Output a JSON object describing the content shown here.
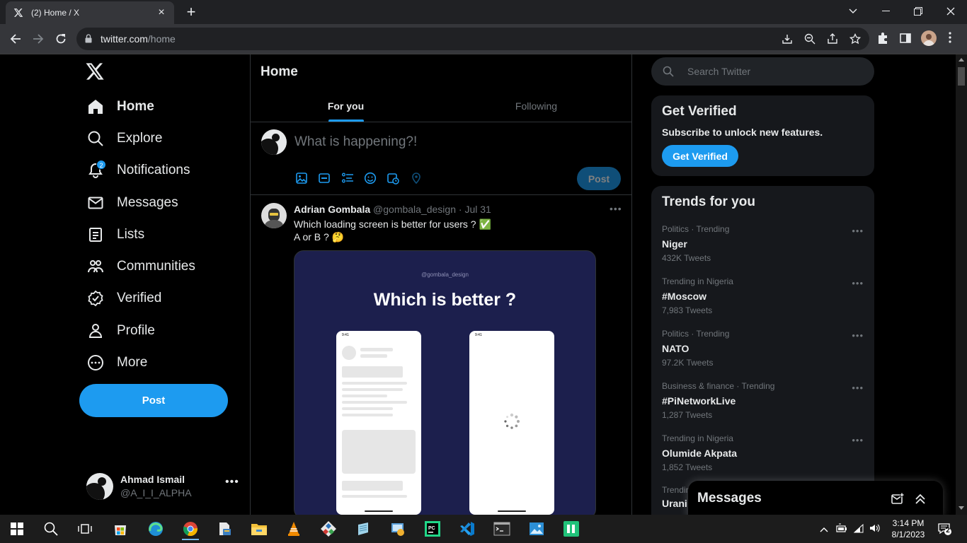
{
  "browser": {
    "tab_title": "(2) Home / X",
    "url_domain": "twitter.com",
    "url_path": "/home"
  },
  "sidebar": {
    "items": [
      {
        "label": "Home",
        "icon": "home-icon"
      },
      {
        "label": "Explore",
        "icon": "search-icon"
      },
      {
        "label": "Notifications",
        "icon": "bell-icon",
        "badge": "2"
      },
      {
        "label": "Messages",
        "icon": "envelope-icon"
      },
      {
        "label": "Lists",
        "icon": "list-icon"
      },
      {
        "label": "Communities",
        "icon": "people-icon"
      },
      {
        "label": "Verified",
        "icon": "verified-badge-icon"
      },
      {
        "label": "Profile",
        "icon": "person-icon"
      },
      {
        "label": "More",
        "icon": "more-circle-icon"
      }
    ],
    "post_button": "Post",
    "account": {
      "name": "Ahmad Ismail",
      "handle": "@A_I_I_ALPHA"
    }
  },
  "main": {
    "title": "Home",
    "tabs": [
      {
        "label": "For you"
      },
      {
        "label": "Following"
      }
    ],
    "composer": {
      "placeholder": "What is happening?!",
      "post_button": "Post"
    },
    "tweet": {
      "author": "Adrian Gombala",
      "handle": "@gombala_design",
      "date": "· Jul 31",
      "line1": "Which loading screen is better for users ? ✅",
      "line2": "A or B ? 🤔",
      "media_watermark": "@gombala_design",
      "media_title": "Which is better ?",
      "phone_a_time": "9:41",
      "phone_b_time": "9:41"
    }
  },
  "right": {
    "search_placeholder": "Search Twitter",
    "verified": {
      "title": "Get Verified",
      "subtitle": "Subscribe to unlock new features.",
      "button": "Get Verified"
    },
    "trends_title": "Trends for you",
    "trends": [
      {
        "context": "Politics · Trending",
        "name": "Niger",
        "count": "432K Tweets"
      },
      {
        "context": "Trending in Nigeria",
        "name": "#Moscow",
        "count": "7,983 Tweets"
      },
      {
        "context": "Politics · Trending",
        "name": "NATO",
        "count": "97.2K Tweets"
      },
      {
        "context": "Business & finance · Trending",
        "name": "#PiNetworkLive",
        "count": "1,287 Tweets"
      },
      {
        "context": "Trending in Nigeria",
        "name": "Olumide Akpata",
        "count": "1,852 Tweets"
      },
      {
        "context": "Trending",
        "name": "Urani",
        "count": ""
      }
    ]
  },
  "messages_drawer": {
    "title": "Messages"
  },
  "taskbar": {
    "time": "3:14 PM",
    "date": "8/1/2023",
    "notification_count": "2"
  },
  "colors": {
    "accent": "#1d9bf0",
    "background": "#000000",
    "muted": "#71767b"
  }
}
